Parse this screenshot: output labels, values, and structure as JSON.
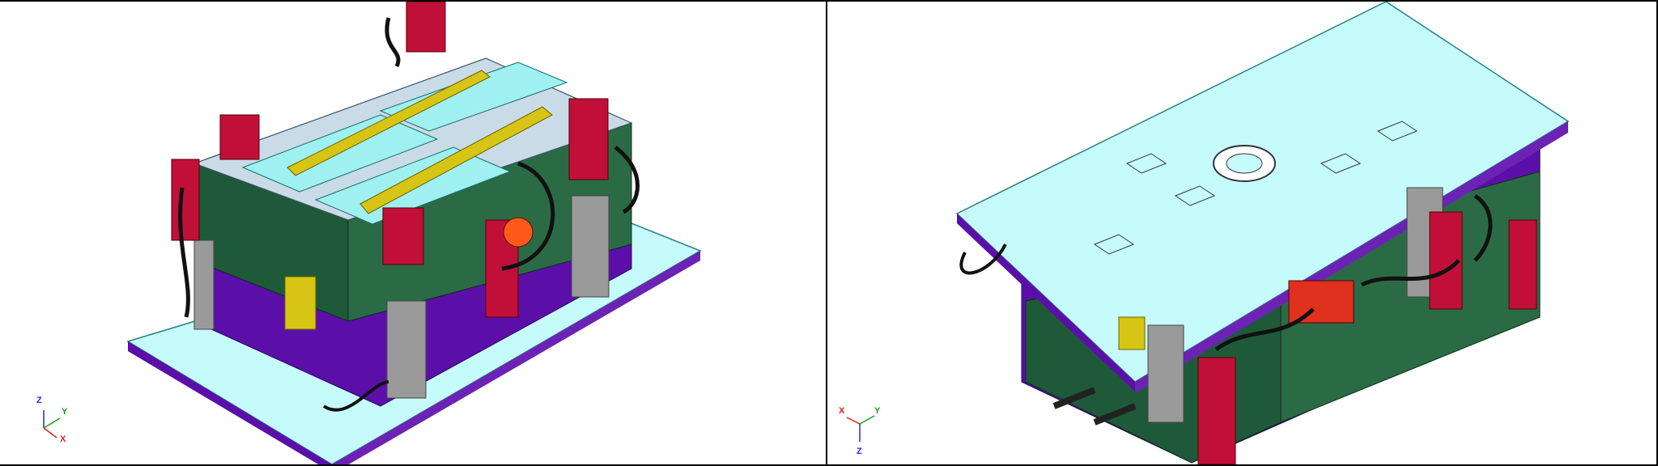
{
  "window": {
    "title": ""
  },
  "viewports": [
    {
      "id": "left",
      "view_name": "isometric-top",
      "triad": {
        "axes": [
          "Z",
          "Y",
          "X"
        ],
        "colors": {
          "Z": "#1f2bd6",
          "Y": "#1aa31a",
          "X": "#e01f1f"
        }
      }
    },
    {
      "id": "right",
      "view_name": "isometric-bottom",
      "triad": {
        "axes": [
          "X",
          "Y",
          "Z"
        ],
        "colors": {
          "X": "#e01f1f",
          "Y": "#1aa31a",
          "Z": "#1f2bd6"
        }
      }
    }
  ],
  "colors": {
    "plate": "#c6fbfb",
    "plate_edge": "#3aa6a6",
    "frame_purple": "#5b0fa8",
    "frame_green": "#1e5a3a",
    "heater_red": "#c0103a",
    "cylinder_yellow": "#d6c514",
    "grid_grey": "#9a9a9a",
    "hose_black": "#111111"
  }
}
